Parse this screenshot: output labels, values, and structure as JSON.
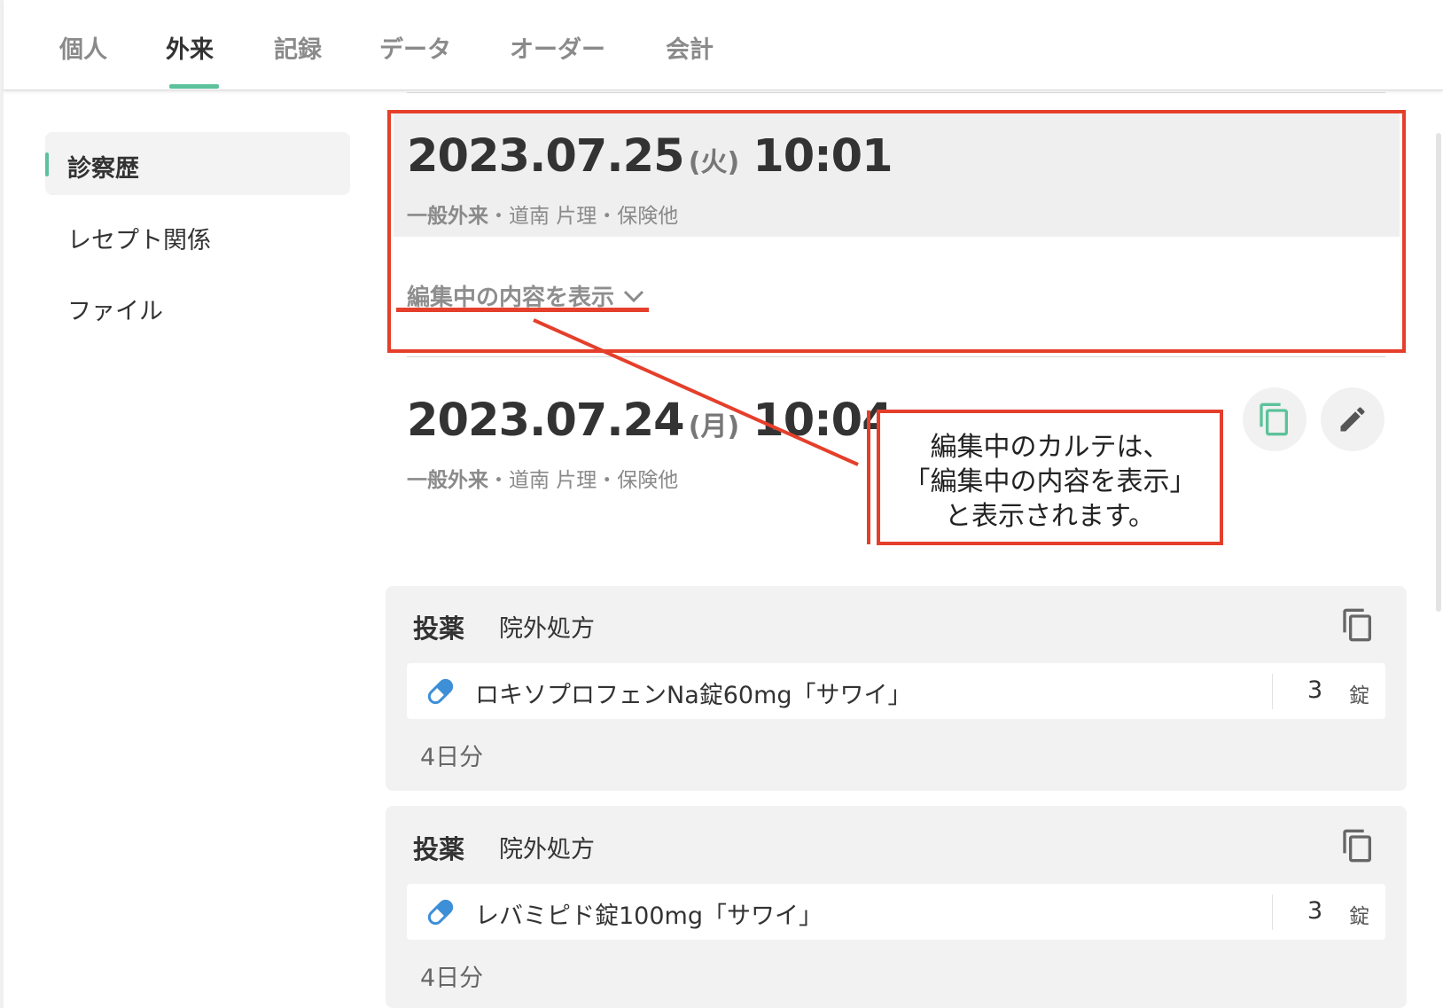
{
  "tabs": [
    {
      "label": "個人",
      "active": false
    },
    {
      "label": "外来",
      "active": true
    },
    {
      "label": "記録",
      "active": false
    },
    {
      "label": "データ",
      "active": false
    },
    {
      "label": "オーダー",
      "active": false
    },
    {
      "label": "会計",
      "active": false
    }
  ],
  "sidebar": {
    "items": [
      {
        "label": "診察歴",
        "active": true
      },
      {
        "label": "レセプト関係",
        "active": false
      },
      {
        "label": "ファイル",
        "active": false
      }
    ]
  },
  "entries": [
    {
      "date": "2023.07.25",
      "weekday": "(火)",
      "time": "10:01",
      "dept": "一般外来",
      "details": "・道南 片理・保険他",
      "expand_label": "編集中の内容を表示"
    },
    {
      "date": "2023.07.24",
      "weekday": "(月)",
      "time": "10:04",
      "dept": "一般外来",
      "details": "・道南 片理・保険他"
    }
  ],
  "prescriptions": [
    {
      "title": "投薬",
      "type": "院外処方",
      "drug": "ロキソプロフェンNa錠60mg「サワイ」",
      "qty": "3",
      "unit": "錠",
      "days": "4日分"
    },
    {
      "title": "投薬",
      "type": "院外処方",
      "drug": "レバミピド錠100mg「サワイ」",
      "qty": "3",
      "unit": "錠",
      "days": "4日分"
    }
  ],
  "annotation": {
    "lines": [
      "編集中のカルテは、",
      "「編集中の内容を表示」",
      "と表示されます。"
    ],
    "color": "#e53f2b"
  },
  "colors": {
    "accent": "#5cc29b",
    "pill": "#3d8fd8",
    "annotation": "#e53f2b"
  },
  "icons": [
    "copy-icon",
    "pencil-icon",
    "chevron-down-icon",
    "pill-icon"
  ]
}
